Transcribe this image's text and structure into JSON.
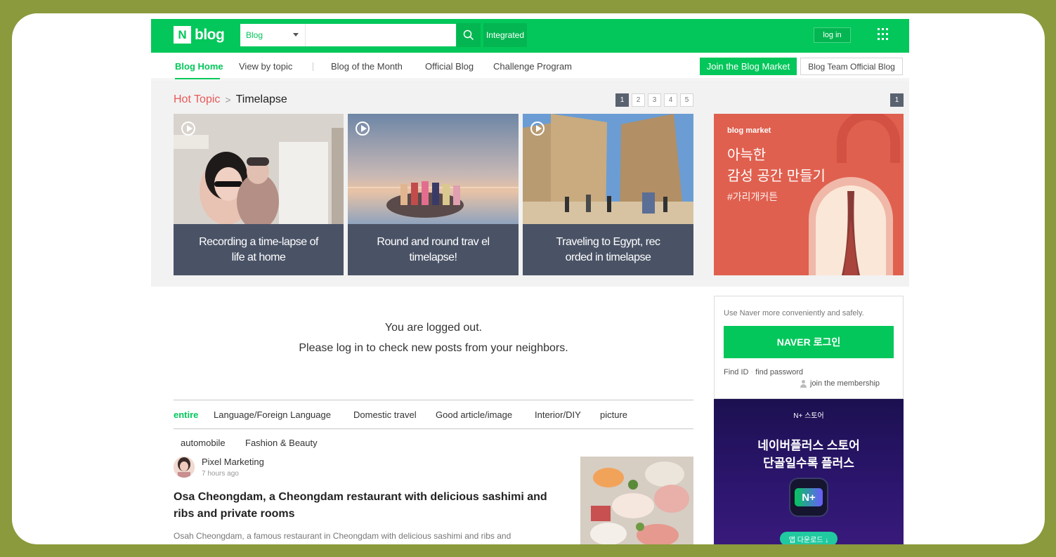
{
  "header": {
    "logo_n": "N",
    "logo_text": "blog",
    "search_scope": "Blog",
    "search_value": "",
    "integrated_label": "Integrated",
    "login_label": "log in"
  },
  "nav": {
    "items": [
      {
        "label": "Blog Home",
        "active": true
      },
      {
        "label": "View by topic"
      },
      {
        "label": "Blog of the Month"
      },
      {
        "label": "Official Blog"
      },
      {
        "label": "Challenge Program"
      }
    ],
    "join_market": "Join the Blog Market",
    "team_blog": "Blog Team Official Blog"
  },
  "hot_topic": {
    "label": "Hot Topic",
    "topic": "Timelapse",
    "pages": [
      "1",
      "2",
      "3",
      "4",
      "5"
    ],
    "current_page": "1",
    "ad_page": "1",
    "cards": [
      {
        "caption": "Recording a time-lapse of life at home"
      },
      {
        "caption": "Round and round trav el timelapse!"
      },
      {
        "caption": "Traveling to Egypt, rec orded in timelapse"
      }
    ]
  },
  "ad_banner": {
    "brand": "blog market",
    "line1": "아늑한",
    "line2": "감성 공간 만들기",
    "tag": "#가리개커튼",
    "color": "#e0604f"
  },
  "logged_out": {
    "line1": "You are logged out.",
    "line2": "Please log in to check new posts from your neighbors."
  },
  "categories": {
    "row1": [
      "entire",
      "Language/Foreign Language",
      "Domestic travel",
      "Good article/image",
      "Interior/DIY",
      "picture"
    ],
    "row2": [
      "automobile",
      "Fashion & Beauty"
    ],
    "active": "entire"
  },
  "post": {
    "author": "Pixel Marketing",
    "time": "7 hours ago",
    "title": "Osa Cheongdam, a Cheongdam restaurant with delicious sashimi and ribs and private rooms",
    "desc": "Osah Cheongdam, a famous restaurant in Cheongdam with delicious sashimi and ribs and"
  },
  "login_box": {
    "hint": "Use Naver more conveniently and safely.",
    "button": "NAVER 로그인",
    "find_id": "Find ID",
    "find_password": "find password",
    "join": "join the membership"
  },
  "store_ad": {
    "brand": "N+ 스토어",
    "line1": "네이버플러스 스토어",
    "line2": "단골일수록 플러스",
    "app_label": "N+",
    "download": "앱 다운로드 ↓"
  },
  "colors": {
    "brand_green": "#03c75a",
    "hot_red": "#e85a5a",
    "caption_bg": "#4a5366"
  }
}
